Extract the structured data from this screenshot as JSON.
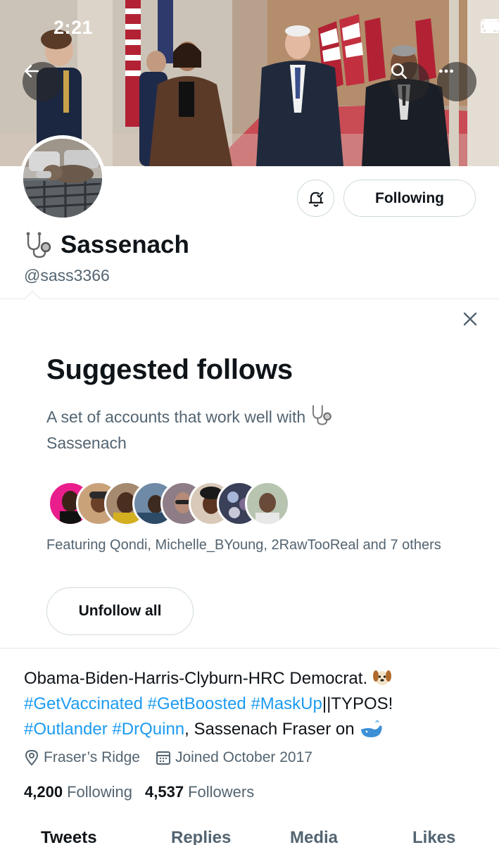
{
  "status_bar": {
    "time": "2:21"
  },
  "header": {
    "back_icon": "arrow-left-icon",
    "search_icon": "search-icon",
    "more_icon": "ellipsis-icon"
  },
  "profile": {
    "display_name": "Sassenach",
    "name_emoji": "stethoscope-icon",
    "handle": "@sass3366",
    "following_label": "Following",
    "notify_icon": "bell-check-icon"
  },
  "suggested": {
    "title": "Suggested follows",
    "description": "A set of accounts that work well with",
    "description_name": "Sassenach",
    "featuring": "Featuring Qondi, Michelle_BYoung, 2RawTooReal and 7 others",
    "unfollow_label": "Unfollow all",
    "close_icon": "close-icon"
  },
  "bio": {
    "line1": "Obama-Biden-Harris-Clyburn-HRC Democrat.",
    "line1_emoji": "dog-face-icon",
    "hashtags_line2": [
      "#GetVaccinated",
      "#GetBoosted",
      "#MaskUp"
    ],
    "line2_tail": "||TYPOS!",
    "hashtags_line3": [
      "#Outlander",
      "#DrQuinn"
    ],
    "line3_tail": ", Sassenach Fraser on",
    "line3_emoji": "whale-icon"
  },
  "meta": {
    "location": "Fraser’s Ridge",
    "joined": "Joined October 2017"
  },
  "stats": {
    "following_count": "4,200",
    "following_label": "Following",
    "followers_count": "4,537",
    "followers_label": "Followers"
  },
  "tabs": [
    {
      "label": "Tweets"
    },
    {
      "label": "Replies"
    },
    {
      "label": "Media"
    },
    {
      "label": "Likes"
    }
  ],
  "colors": {
    "link": "#1d9bf0",
    "secondary_text": "#536471",
    "border": "#cfd9de"
  }
}
